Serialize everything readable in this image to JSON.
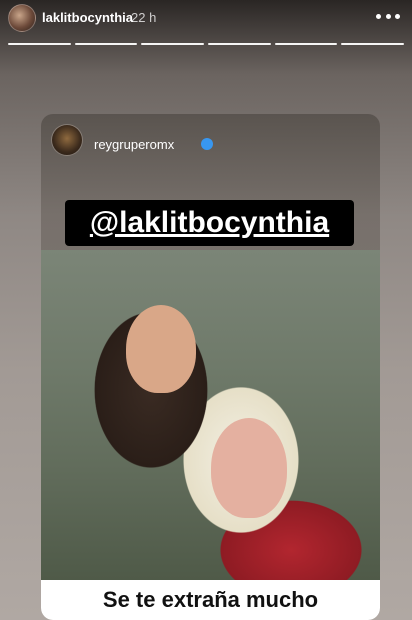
{
  "story": {
    "username": "laklitbocynthia",
    "time": "22 h",
    "progress_segments": 6,
    "more_icon": "ellipsis-icon"
  },
  "card": {
    "username": "reygruperomx",
    "verified": true,
    "mention": "@laklitbocynthia",
    "caption": "Se te extraña mucho"
  }
}
